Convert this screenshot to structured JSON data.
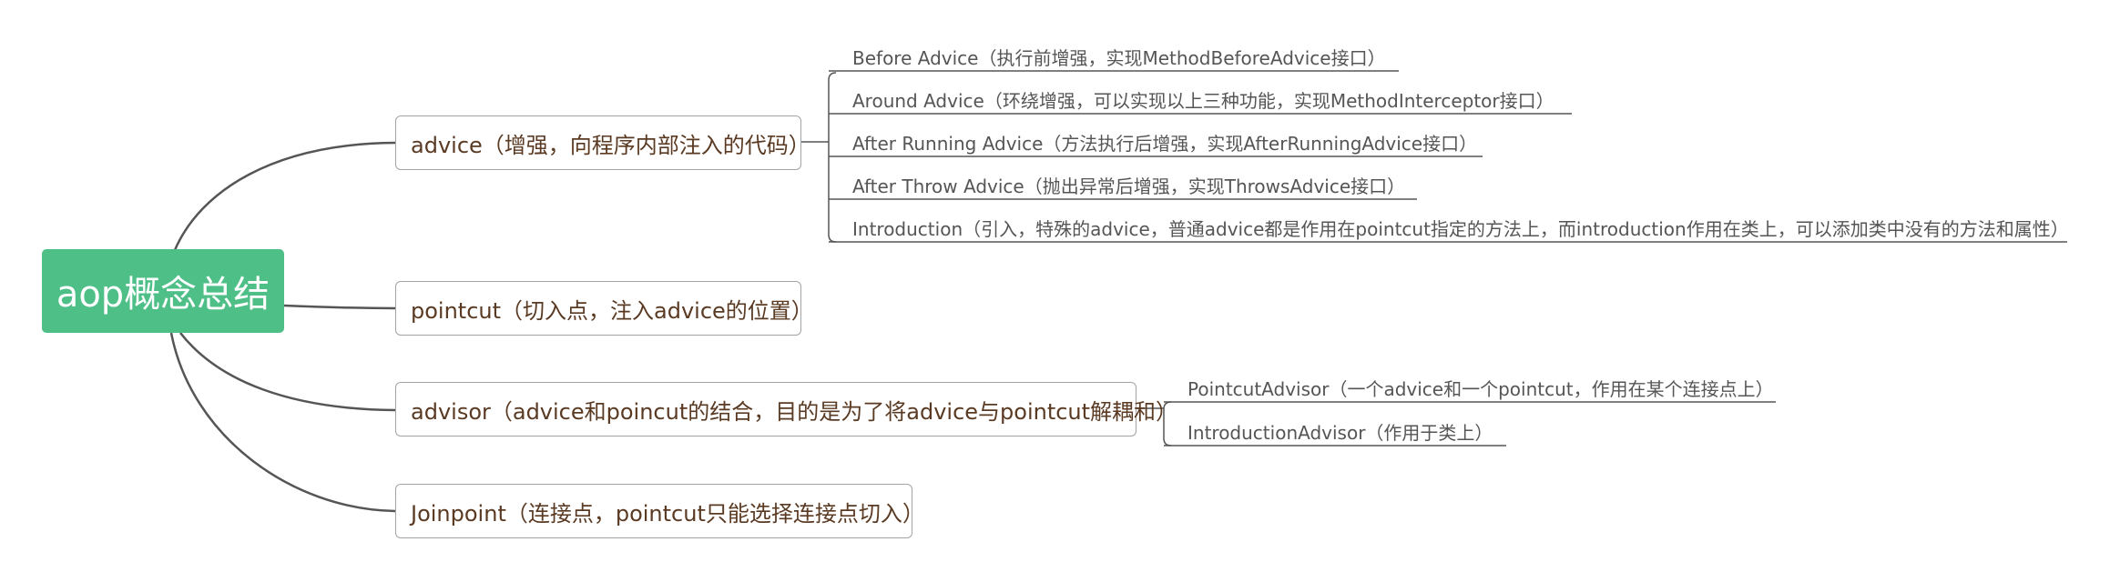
{
  "root": {
    "label": "aop概念总结"
  },
  "branches": [
    {
      "label": "advice（增强，向程序内部注入的代码）",
      "children": [
        "Before Advice（执行前增强，实现MethodBeforeAdvice接口）",
        "Around Advice（环绕增强，可以实现以上三种功能，实现MethodInterceptor接口）",
        "After Running Advice（方法执行后增强，实现AfterRunningAdvice接口）",
        "After Throw Advice（抛出异常后增强，实现ThrowsAdvice接口）",
        "Introduction（引入，特殊的advice，普通advice都是作用在pointcut指定的方法上，而introduction作用在类上，可以添加类中没有的方法和属性）"
      ]
    },
    {
      "label": "pointcut（切入点，注入advice的位置）",
      "children": []
    },
    {
      "label": "advisor（advice和poincut的结合，目的是为了将advice与pointcut解耦和）",
      "children": [
        "PointcutAdvisor（一个advice和一个pointcut，作用在某个连接点上）",
        "IntroductionAdvisor（作用于类上）"
      ]
    },
    {
      "label": "Joinpoint（连接点，pointcut只能选择连接点切入）",
      "children": []
    }
  ],
  "colors": {
    "root_fill": "#4dbf87",
    "connector": "#555555",
    "box_border": "#a3a3a3",
    "branch_text": "#5a3a22",
    "leaf_text": "#555555"
  }
}
